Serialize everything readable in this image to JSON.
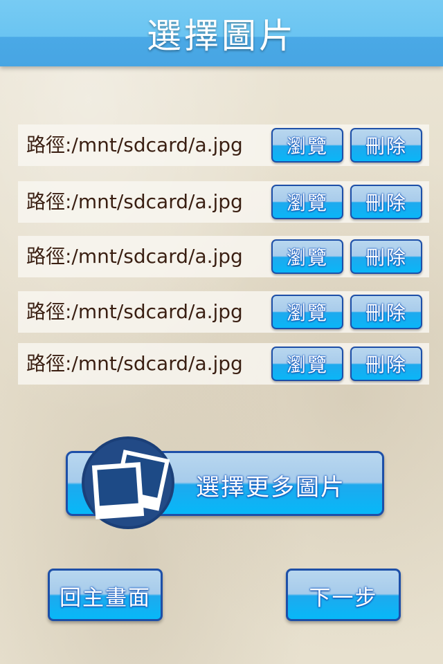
{
  "header": {
    "title": "選擇圖片"
  },
  "files": [
    {
      "path": "路徑:/mnt/sdcard/a.jpg",
      "browse_label": "瀏覽",
      "delete_label": "刪除"
    },
    {
      "path": "路徑:/mnt/sdcard/a.jpg",
      "browse_label": "瀏覽",
      "delete_label": "刪除"
    },
    {
      "path": "路徑:/mnt/sdcard/a.jpg",
      "browse_label": "瀏覽",
      "delete_label": "刪除"
    },
    {
      "path": "路徑:/mnt/sdcard/a.jpg",
      "browse_label": "瀏覽",
      "delete_label": "刪除"
    },
    {
      "path": "路徑:/mnt/sdcard/a.jpg",
      "browse_label": "瀏覽",
      "delete_label": "刪除"
    }
  ],
  "select_more": {
    "label": "選擇更多圖片",
    "icon": "photos-icon"
  },
  "footer": {
    "home_label": "回主畫面",
    "next_label": "下一步"
  },
  "colors": {
    "header": "#6ac4f2",
    "button_border": "#1d4fa8",
    "button_fill": "#0ab6f7",
    "path_text": "#3a1f12"
  }
}
